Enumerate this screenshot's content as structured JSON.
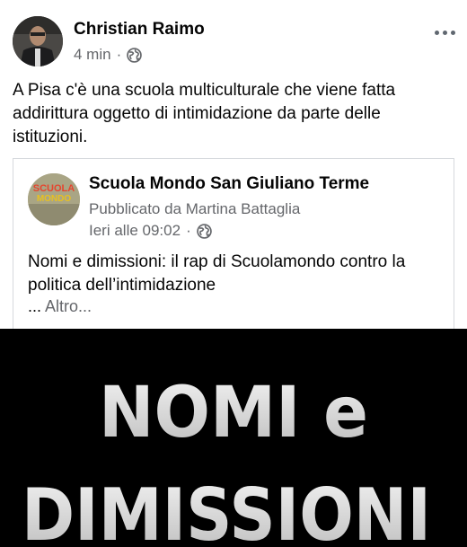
{
  "post": {
    "author": "Christian Raimo",
    "time": "4 min",
    "separator": "·",
    "text": "A Pisa c'è una scuola multiculturale che viene fatta addirittura oggetto di intimidazione da parte delle istituzioni."
  },
  "shared": {
    "page_name": "Scuola Mondo San Giuliano Terme",
    "published_by": "Pubblicato da Martina Battaglia",
    "time": "Ieri alle 09:02",
    "separator": "·",
    "text": "Nomi e dimissioni: il rap di Scuolamondo contro la politica dell’intimidazione",
    "more_ellipsis": "...",
    "more_label": "Altro..."
  },
  "page_logo_text": [
    "SCUOLA",
    "MONDO"
  ],
  "video": {
    "title_line1": "NOMI e",
    "title_line2": "DIMISSIONI"
  },
  "colors": {
    "text": "#050505",
    "secondary": "#65676b",
    "card_border": "#d6d9dd",
    "video_bg": "#000000",
    "video_text": "#ffffff"
  },
  "icons": [
    "globe-icon",
    "more-options-icon"
  ]
}
